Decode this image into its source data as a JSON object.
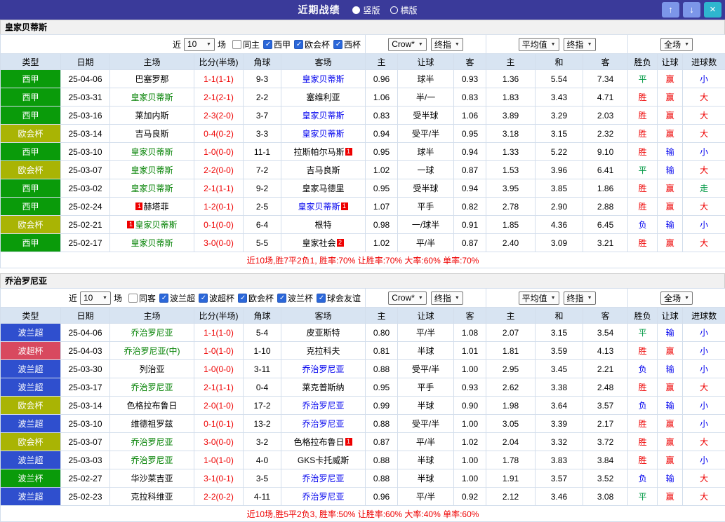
{
  "topbar": {
    "title": "近期战绩",
    "radios": [
      {
        "label": "竖版",
        "selected": true
      },
      {
        "label": "横版",
        "selected": false
      }
    ],
    "buttons": {
      "up": "↑",
      "down": "↓",
      "close": "×"
    }
  },
  "columns": [
    "类型",
    "日期",
    "主场",
    "比分(半场)",
    "角球",
    "客场",
    "主",
    "让球",
    "客",
    "主",
    "和",
    "客",
    "胜负",
    "让球",
    "进球数"
  ],
  "colors": {
    "win": "#EE0000",
    "lose": "#0000EE",
    "draw": "#009944",
    "home_team": "#008000",
    "away_team": "#0000EE",
    "neutral_team": "#000000",
    "score": "#EE0000",
    "topbar_bg": "#3A3A9A",
    "leagues": {
      "西甲": "#0A9B0A",
      "欧会杯": "#A9B404",
      "波兰超": "#2F4FCE",
      "波超杯": "#D8495F",
      "波兰杯": "#0A9B0A"
    }
  },
  "sections": [
    {
      "title": "皇家贝蒂斯",
      "filters": {
        "near_label": "近",
        "count": "10",
        "games_label": "场",
        "checkboxes": [
          {
            "label": "同主",
            "checked": false
          },
          {
            "label": "西甲",
            "checked": true
          },
          {
            "label": "欧会杯",
            "checked": true
          },
          {
            "label": "西杯",
            "checked": true
          }
        ]
      },
      "selects": {
        "ah_source": "Crow*",
        "ah_time": "终指",
        "eu_source": "平均值",
        "eu_time": "终指",
        "scope": "全场"
      },
      "rows": [
        {
          "league": "西甲",
          "date": "25-04-06",
          "home": {
            "name": "巴塞罗那",
            "color": "black"
          },
          "score": "1-1(1-1)",
          "corners": "9-3",
          "away": {
            "name": "皇家贝蒂斯",
            "color": "blue"
          },
          "ah": [
            "0.96",
            "球半",
            "0.93"
          ],
          "eu": [
            "1.36",
            "5.54",
            "7.34"
          ],
          "outcome": "平",
          "ah_outcome": "赢",
          "ou_outcome": "小"
        },
        {
          "league": "西甲",
          "date": "25-03-31",
          "home": {
            "name": "皇家贝蒂斯",
            "color": "green"
          },
          "score": "2-1(2-1)",
          "corners": "2-2",
          "away": {
            "name": "塞维利亚",
            "color": "black"
          },
          "ah": [
            "1.06",
            "半/一",
            "0.83"
          ],
          "eu": [
            "1.83",
            "3.43",
            "4.71"
          ],
          "outcome": "胜",
          "ah_outcome": "赢",
          "ou_outcome": "大"
        },
        {
          "league": "西甲",
          "date": "25-03-16",
          "home": {
            "name": "莱加内斯",
            "color": "black"
          },
          "score": "2-3(2-0)",
          "corners": "3-7",
          "away": {
            "name": "皇家贝蒂斯",
            "color": "blue"
          },
          "ah": [
            "0.83",
            "受半球",
            "1.06"
          ],
          "eu": [
            "3.89",
            "3.29",
            "2.03"
          ],
          "outcome": "胜",
          "ah_outcome": "赢",
          "ou_outcome": "大"
        },
        {
          "league": "欧会杯",
          "date": "25-03-14",
          "home": {
            "name": "吉马良斯",
            "color": "black"
          },
          "score": "0-4(0-2)",
          "corners": "3-3",
          "away": {
            "name": "皇家贝蒂斯",
            "color": "blue"
          },
          "ah": [
            "0.94",
            "受平/半",
            "0.95"
          ],
          "eu": [
            "3.18",
            "3.15",
            "2.32"
          ],
          "outcome": "胜",
          "ah_outcome": "赢",
          "ou_outcome": "大"
        },
        {
          "league": "西甲",
          "date": "25-03-10",
          "home": {
            "name": "皇家贝蒂斯",
            "color": "green"
          },
          "score": "1-0(0-0)",
          "corners": "11-1",
          "away": {
            "name": "拉斯帕尔马斯",
            "color": "black",
            "card_post": "1"
          },
          "ah": [
            "0.95",
            "球半",
            "0.94"
          ],
          "eu": [
            "1.33",
            "5.22",
            "9.10"
          ],
          "outcome": "胜",
          "ah_outcome": "输",
          "ou_outcome": "小"
        },
        {
          "league": "欧会杯",
          "date": "25-03-07",
          "home": {
            "name": "皇家贝蒂斯",
            "color": "green"
          },
          "score": "2-2(0-0)",
          "corners": "7-2",
          "away": {
            "name": "吉马良斯",
            "color": "black"
          },
          "ah": [
            "1.02",
            "一球",
            "0.87"
          ],
          "eu": [
            "1.53",
            "3.96",
            "6.41"
          ],
          "outcome": "平",
          "ah_outcome": "输",
          "ou_outcome": "大"
        },
        {
          "league": "西甲",
          "date": "25-03-02",
          "home": {
            "name": "皇家贝蒂斯",
            "color": "green"
          },
          "score": "2-1(1-1)",
          "corners": "9-2",
          "away": {
            "name": "皇家马德里",
            "color": "black"
          },
          "ah": [
            "0.95",
            "受半球",
            "0.94"
          ],
          "eu": [
            "3.95",
            "3.85",
            "1.86"
          ],
          "outcome": "胜",
          "ah_outcome": "赢",
          "ou_outcome": "走"
        },
        {
          "league": "西甲",
          "date": "25-02-24",
          "home": {
            "name": "赫塔菲",
            "color": "black",
            "card_pre": "1"
          },
          "score": "1-2(0-1)",
          "corners": "2-5",
          "away": {
            "name": "皇家贝蒂斯",
            "color": "blue",
            "card_post": "1"
          },
          "ah": [
            "1.07",
            "平手",
            "0.82"
          ],
          "eu": [
            "2.78",
            "2.90",
            "2.88"
          ],
          "outcome": "胜",
          "ah_outcome": "赢",
          "ou_outcome": "大"
        },
        {
          "league": "欧会杯",
          "date": "25-02-21",
          "home": {
            "name": "皇家贝蒂斯",
            "color": "green",
            "card_pre": "1"
          },
          "score": "0-1(0-0)",
          "corners": "6-4",
          "away": {
            "name": "根特",
            "color": "black"
          },
          "ah": [
            "0.98",
            "一/球半",
            "0.91"
          ],
          "eu": [
            "1.85",
            "4.36",
            "6.45"
          ],
          "outcome": "负",
          "ah_outcome": "输",
          "ou_outcome": "小"
        },
        {
          "league": "西甲",
          "date": "25-02-17",
          "home": {
            "name": "皇家贝蒂斯",
            "color": "green"
          },
          "score": "3-0(0-0)",
          "corners": "5-5",
          "away": {
            "name": "皇家社会",
            "color": "black",
            "card_post": "2"
          },
          "ah": [
            "1.02",
            "平/半",
            "0.87"
          ],
          "eu": [
            "2.40",
            "3.09",
            "3.21"
          ],
          "outcome": "胜",
          "ah_outcome": "赢",
          "ou_outcome": "大"
        }
      ],
      "summary": "近10场,胜7平2负1, 胜率:70% 让胜率:70% 大率:60% 单率:70%"
    },
    {
      "title": "乔治罗尼亚",
      "filters": {
        "near_label": "近",
        "count": "10",
        "games_label": "场",
        "checkboxes": [
          {
            "label": "同客",
            "checked": false
          },
          {
            "label": "波兰超",
            "checked": true
          },
          {
            "label": "波超杯",
            "checked": true
          },
          {
            "label": "欧会杯",
            "checked": true
          },
          {
            "label": "波兰杯",
            "checked": true
          },
          {
            "label": "球会友谊",
            "checked": true
          }
        ]
      },
      "selects": {
        "ah_source": "Crow*",
        "ah_time": "终指",
        "eu_source": "平均值",
        "eu_time": "终指",
        "scope": "全场"
      },
      "rows": [
        {
          "league": "波兰超",
          "date": "25-04-06",
          "home": {
            "name": "乔治罗尼亚",
            "color": "green"
          },
          "score": "1-1(1-0)",
          "corners": "5-4",
          "away": {
            "name": "皮亚斯特",
            "color": "black"
          },
          "ah": [
            "0.80",
            "平/半",
            "1.08"
          ],
          "eu": [
            "2.07",
            "3.15",
            "3.54"
          ],
          "outcome": "平",
          "ah_outcome": "输",
          "ou_outcome": "小"
        },
        {
          "league": "波超杯",
          "date": "25-04-03",
          "home": {
            "name": "乔治罗尼亚(中)",
            "color": "green"
          },
          "score": "1-0(1-0)",
          "corners": "1-10",
          "away": {
            "name": "克拉科夫",
            "color": "black"
          },
          "ah": [
            "0.81",
            "半球",
            "1.01"
          ],
          "eu": [
            "1.81",
            "3.59",
            "4.13"
          ],
          "outcome": "胜",
          "ah_outcome": "赢",
          "ou_outcome": "小"
        },
        {
          "league": "波兰超",
          "date": "25-03-30",
          "home": {
            "name": "列治亚",
            "color": "black"
          },
          "score": "1-0(0-0)",
          "corners": "3-11",
          "away": {
            "name": "乔治罗尼亚",
            "color": "blue"
          },
          "ah": [
            "0.88",
            "受平/半",
            "1.00"
          ],
          "eu": [
            "2.95",
            "3.45",
            "2.21"
          ],
          "outcome": "负",
          "ah_outcome": "输",
          "ou_outcome": "小"
        },
        {
          "league": "波兰超",
          "date": "25-03-17",
          "home": {
            "name": "乔治罗尼亚",
            "color": "green"
          },
          "score": "2-1(1-1)",
          "corners": "0-4",
          "away": {
            "name": "莱克普斯纳",
            "color": "black"
          },
          "ah": [
            "0.95",
            "平手",
            "0.93"
          ],
          "eu": [
            "2.62",
            "3.38",
            "2.48"
          ],
          "outcome": "胜",
          "ah_outcome": "赢",
          "ou_outcome": "大"
        },
        {
          "league": "欧会杯",
          "date": "25-03-14",
          "home": {
            "name": "色格拉布鲁日",
            "color": "black"
          },
          "score": "2-0(1-0)",
          "corners": "17-2",
          "away": {
            "name": "乔治罗尼亚",
            "color": "blue"
          },
          "ah": [
            "0.99",
            "半球",
            "0.90"
          ],
          "eu": [
            "1.98",
            "3.64",
            "3.57"
          ],
          "outcome": "负",
          "ah_outcome": "输",
          "ou_outcome": "小"
        },
        {
          "league": "波兰超",
          "date": "25-03-10",
          "home": {
            "name": "维德祖罗兹",
            "color": "black"
          },
          "score": "0-1(0-1)",
          "corners": "13-2",
          "away": {
            "name": "乔治罗尼亚",
            "color": "blue"
          },
          "ah": [
            "0.88",
            "受平/半",
            "1.00"
          ],
          "eu": [
            "3.05",
            "3.39",
            "2.17"
          ],
          "outcome": "胜",
          "ah_outcome": "赢",
          "ou_outcome": "小"
        },
        {
          "league": "欧会杯",
          "date": "25-03-07",
          "home": {
            "name": "乔治罗尼亚",
            "color": "green"
          },
          "score": "3-0(0-0)",
          "corners": "3-2",
          "away": {
            "name": "色格拉布鲁日",
            "color": "black",
            "card_post": "1"
          },
          "ah": [
            "0.87",
            "平/半",
            "1.02"
          ],
          "eu": [
            "2.04",
            "3.32",
            "3.72"
          ],
          "outcome": "胜",
          "ah_outcome": "赢",
          "ou_outcome": "大"
        },
        {
          "league": "波兰超",
          "date": "25-03-03",
          "home": {
            "name": "乔治罗尼亚",
            "color": "green"
          },
          "score": "1-0(1-0)",
          "corners": "4-0",
          "away": {
            "name": "GKS卡托威斯",
            "color": "black"
          },
          "ah": [
            "0.88",
            "半球",
            "1.00"
          ],
          "eu": [
            "1.78",
            "3.83",
            "3.84"
          ],
          "outcome": "胜",
          "ah_outcome": "赢",
          "ou_outcome": "小"
        },
        {
          "league": "波兰杯",
          "date": "25-02-27",
          "home": {
            "name": "华沙莱吉亚",
            "color": "black"
          },
          "score": "3-1(0-1)",
          "corners": "3-5",
          "away": {
            "name": "乔治罗尼亚",
            "color": "blue"
          },
          "ah": [
            "0.88",
            "半球",
            "1.00"
          ],
          "eu": [
            "1.91",
            "3.57",
            "3.52"
          ],
          "outcome": "负",
          "ah_outcome": "输",
          "ou_outcome": "大"
        },
        {
          "league": "波兰超",
          "date": "25-02-23",
          "home": {
            "name": "克拉科维亚",
            "color": "black"
          },
          "score": "2-2(0-2)",
          "corners": "4-11",
          "away": {
            "name": "乔治罗尼亚",
            "color": "blue"
          },
          "ah": [
            "0.96",
            "平/半",
            "0.92"
          ],
          "eu": [
            "2.12",
            "3.46",
            "3.08"
          ],
          "outcome": "平",
          "ah_outcome": "赢",
          "ou_outcome": "大"
        }
      ],
      "summary": "近10场,胜5平2负3, 胜率:50% 让胜率:60% 大率:40% 单率:60%"
    }
  ]
}
